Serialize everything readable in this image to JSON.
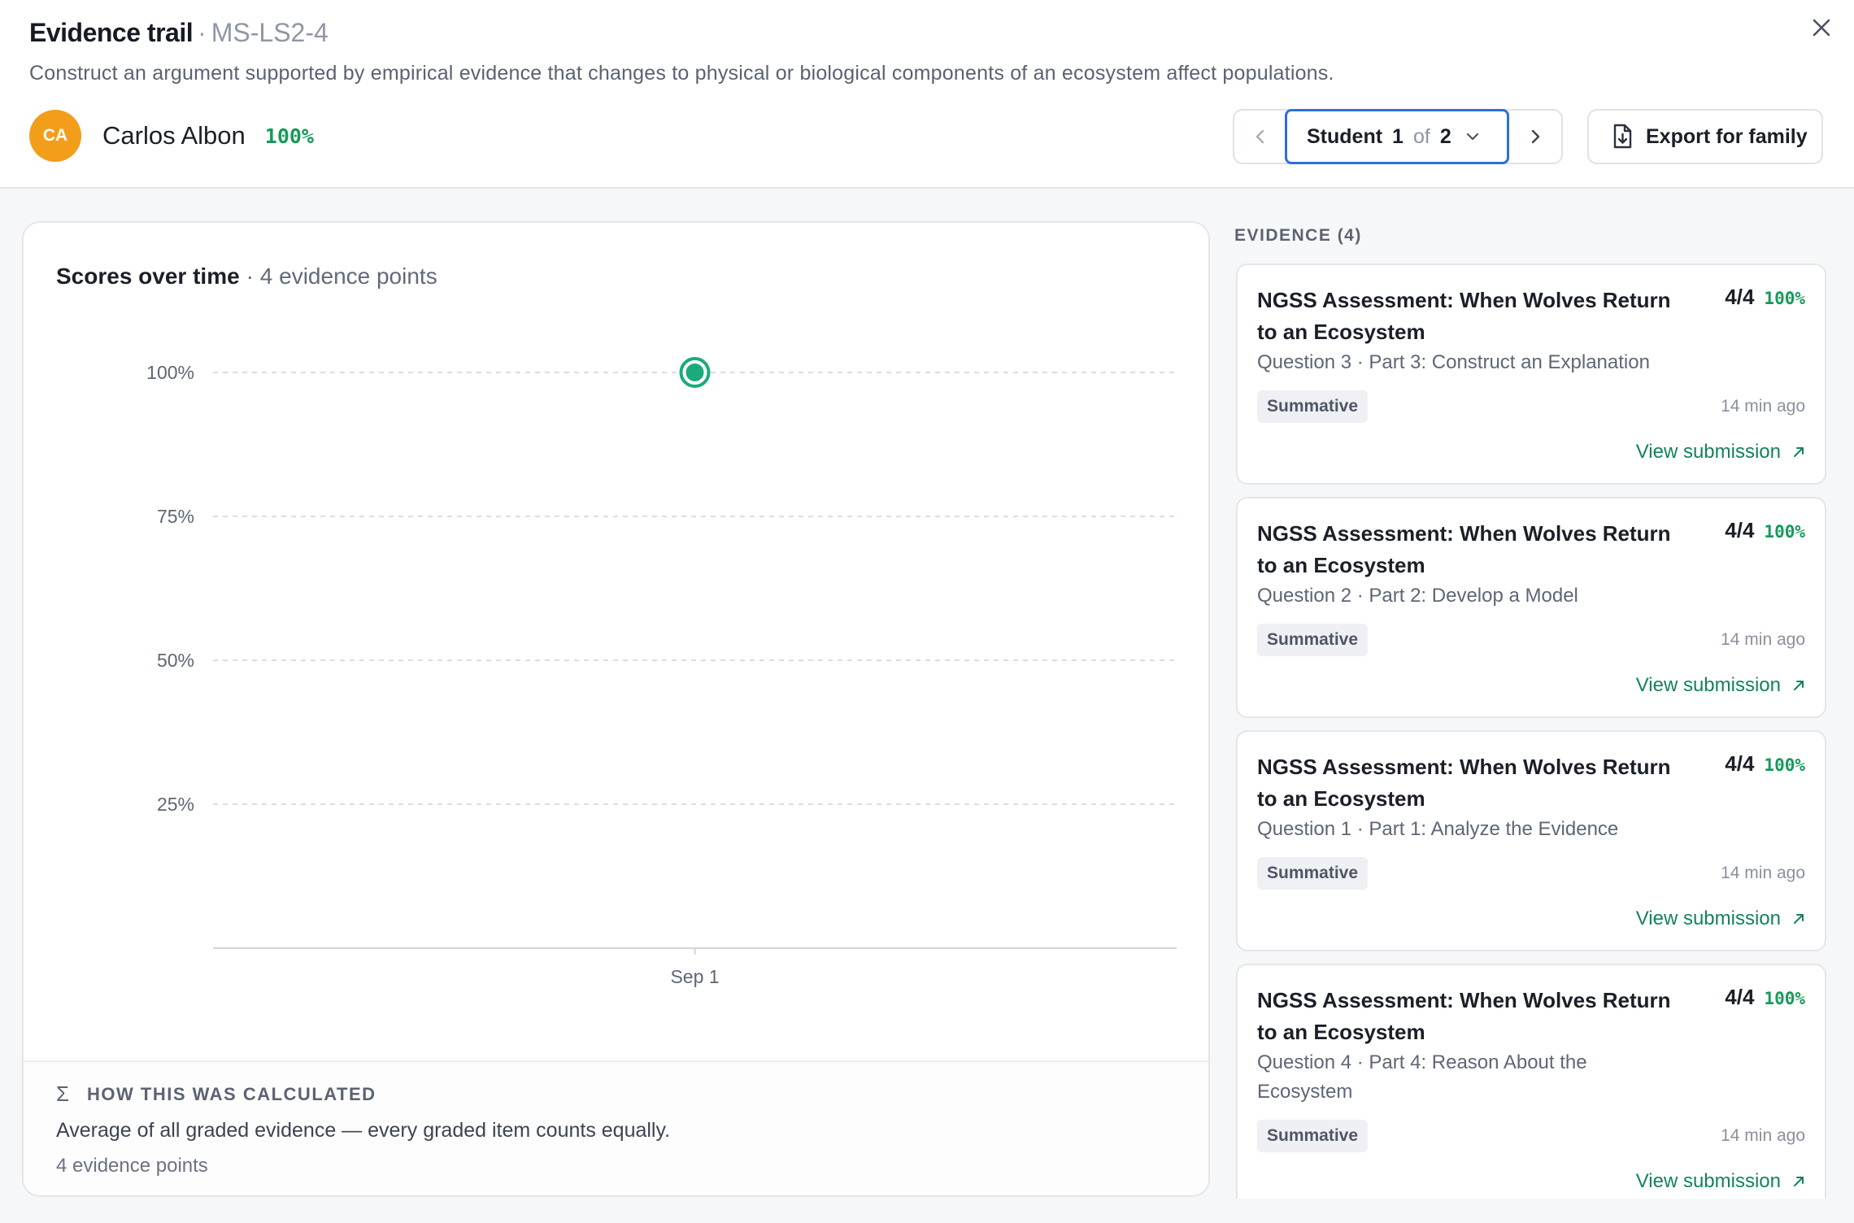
{
  "header": {
    "title": "Evidence trail",
    "separator": "·",
    "standard_code": "MS-LS2-4",
    "description": "Construct an argument supported by empirical evidence that changes to physical or biological components of an ecosystem affect populations."
  },
  "student": {
    "initials": "CA",
    "name": "Carlos Albon",
    "score": "100%",
    "avatar_color": "#f29e1a"
  },
  "pager": {
    "label": "Student",
    "current": "1",
    "of": "of",
    "total": "2"
  },
  "export": {
    "label": "Export for family"
  },
  "chart": {
    "title": "Scores over time",
    "subtitle": "· 4 evidence points"
  },
  "chart_data": {
    "type": "scatter",
    "x_tick_labels": [
      "Sep 1"
    ],
    "y_tick_labels": [
      "100%",
      "75%",
      "50%",
      "25%"
    ],
    "y_ticks": [
      100,
      75,
      50,
      25
    ],
    "ylim": [
      0,
      100
    ],
    "points": [
      {
        "x": "Sep 1",
        "y": 100
      }
    ],
    "grid": true,
    "point_color": "#1aaa7d"
  },
  "calculation": {
    "title": "HOW THIS WAS CALCULATED",
    "description": "Average of all graded evidence — every graded item counts equally.",
    "count": "4 evidence points"
  },
  "evidence": {
    "heading": "EVIDENCE (4)",
    "items": [
      {
        "title": "NGSS Assessment: When Wolves Return to an Ecosystem",
        "subtitle": "Question 3 · Part 3: Construct an Explanation",
        "score": "4/4",
        "percent": "100%",
        "badge": "Summative",
        "time": "14 min ago",
        "link": "View submission"
      },
      {
        "title": "NGSS Assessment: When Wolves Return to an Ecosystem",
        "subtitle": "Question 2 · Part 2: Develop a Model",
        "score": "4/4",
        "percent": "100%",
        "badge": "Summative",
        "time": "14 min ago",
        "link": "View submission"
      },
      {
        "title": "NGSS Assessment: When Wolves Return to an Ecosystem",
        "subtitle": "Question 1 · Part 1: Analyze the Evidence",
        "score": "4/4",
        "percent": "100%",
        "badge": "Summative",
        "time": "14 min ago",
        "link": "View submission"
      },
      {
        "title": "NGSS Assessment: When Wolves Return to an Ecosystem",
        "subtitle": "Question 4 · Part 4: Reason About the Ecosystem",
        "score": "4/4",
        "percent": "100%",
        "badge": "Summative",
        "time": "14 min ago",
        "link": "View submission"
      }
    ]
  }
}
